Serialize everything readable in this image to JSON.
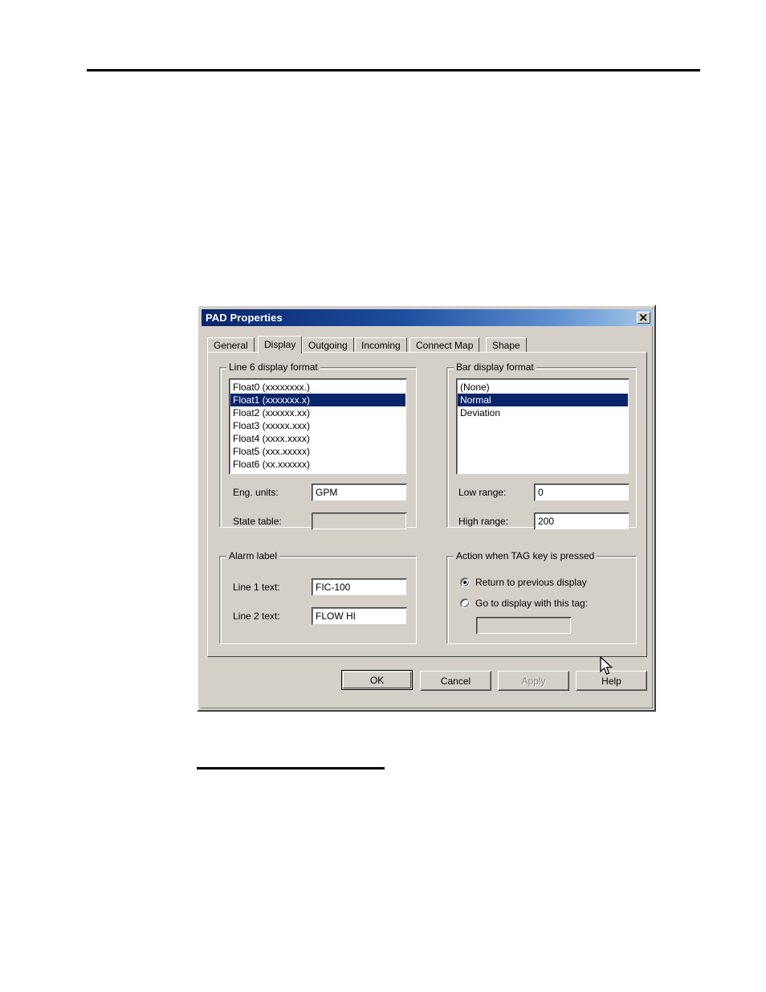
{
  "dialog": {
    "title": "PAD Properties",
    "close_icon": "close-icon",
    "tabs": [
      {
        "label": "General",
        "active": false
      },
      {
        "label": "Display",
        "active": true
      },
      {
        "label": "Outgoing",
        "active": false
      },
      {
        "label": "Incoming",
        "active": false
      },
      {
        "label": "Connect Map",
        "active": false
      },
      {
        "label": "Shape",
        "active": false
      }
    ],
    "line_format_group": {
      "title": "Line 6 display format",
      "items": [
        {
          "label": "Float0 (xxxxxxxx.)",
          "selected": false
        },
        {
          "label": "Float1 (xxxxxxx.x)",
          "selected": true
        },
        {
          "label": "Float2 (xxxxxx.xx)",
          "selected": false
        },
        {
          "label": "Float3 (xxxxx.xxx)",
          "selected": false
        },
        {
          "label": "Float4 (xxxx.xxxx)",
          "selected": false
        },
        {
          "label": "Float5 (xxx.xxxxx)",
          "selected": false
        },
        {
          "label": "Float6 (xx.xxxxxx)",
          "selected": false
        }
      ],
      "eng_units_label": "Eng. units:",
      "eng_units_value": "GPM",
      "state_table_label": "State table:",
      "state_table_value": ""
    },
    "bar_format_group": {
      "title": "Bar display format",
      "items": [
        {
          "label": "(None)",
          "selected": false
        },
        {
          "label": "Normal",
          "selected": true
        },
        {
          "label": "Deviation",
          "selected": false
        }
      ],
      "low_range_label": "Low range:",
      "low_range_value": "0",
      "high_range_label": "High range:",
      "high_range_value": "200"
    },
    "alarm_label_group": {
      "title": "Alarm label",
      "line1_label": "Line 1 text:",
      "line1_value": "FIC-100",
      "line2_label": "Line 2 text:",
      "line2_value": "FLOW HI"
    },
    "tag_action_group": {
      "title": "Action when TAG key is pressed",
      "option1_label": "Return to previous display",
      "option1_selected": true,
      "option2_label": "Go to display with this tag:",
      "option2_selected": false,
      "tag_value": ""
    },
    "buttons": {
      "ok": "OK",
      "cancel": "Cancel",
      "apply": "Apply",
      "help": "Help"
    },
    "colors": {
      "face": "#d4d0c8",
      "selection": "#0a246a",
      "title_gradient_start": "#0a246a",
      "title_gradient_end": "#a6c8ea"
    }
  }
}
